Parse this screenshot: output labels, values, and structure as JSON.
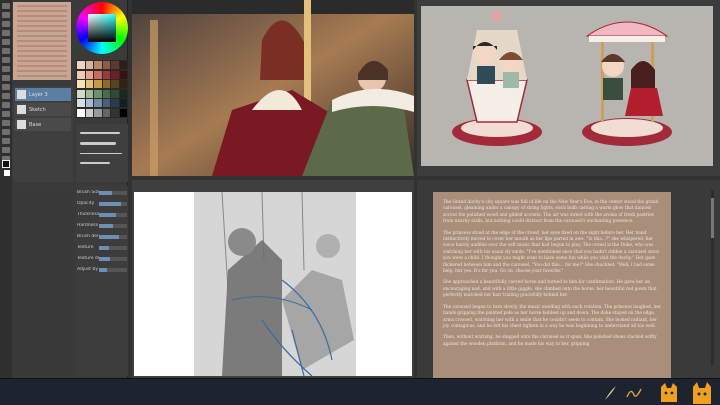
{
  "layers": {
    "items": [
      {
        "label": "Layer 3"
      },
      {
        "label": "Sketch"
      },
      {
        "label": "Base"
      }
    ]
  },
  "tool_properties": {
    "rows": [
      {
        "label": "Brush Size",
        "value": 0.45
      },
      {
        "label": "Opacity",
        "value": 0.8
      },
      {
        "label": "Thickness",
        "value": 0.6
      },
      {
        "label": "Hardness",
        "value": 0.5
      },
      {
        "label": "Brush density",
        "value": 0.7
      },
      {
        "label": "Texture",
        "value": 0.35
      },
      {
        "label": "Texture density",
        "value": 0.4
      },
      {
        "label": "Adjust by speed",
        "value": 0.3
      }
    ]
  },
  "story": {
    "paragraphs": [
      "The Grand duchy's city square was full of life on the New Year's Eve, in the center stood the grand carousel, gleaming under a canopy of string lights, each bulb casting a warm glow that danced across the polished wood and gilded accents. The air was sweet with the aroma of fresh pastries from nearby stalls, but nothing could distract from the carousel's enchanting presence.",
      "The princess stood at the edge of the crowd, her eyes fixed on the sight before her. Her hand instinctively moved to cover her mouth as her lips parted in awe. \"Is this...?\" she whispered, her voice barely audible over the soft music that had begun to play. The crowd is the Duke, who was watching her with his usual sly smile. \"I've mentioned once that you hadn't ridden a carousel since you were a child. I thought you might want to have some fun while you visit the duchy.\" Her gaze flickered between him and the carousel. \"You did this... for me?\" She chuckled. \"Well, I had some help, but yes. It's for you. Go on, choose your favorite.\"",
      "She approached a beautifully carved horse and turned to him for confirmation. He gave her an encouraging nod, and with a little giggle, she climbed onto the horse, her beautiful red gown that perfectly matched her hair trailing gracefully behind her.",
      "The carousel began to turn slowly, the music swelling with each rotation. The princess laughed, her hands gripping the painted pole as her horse bobbed up and down. The duke stayed on the edge, arms crossed, watching her with a smile that he couldn't seem to contain. She looked radiant, her joy contagious, and he felt his chest tighten in a way he was beginning to understand all too well.",
      "Then, without warning, he stepped onto the carousel as it spun. She polished shoes clacked softly against the wooden platform, and he made his way to her, gripping"
    ]
  },
  "colors": {
    "accent": "#5d7ea3",
    "memo": "#c9a594",
    "page": "#a98f7b",
    "taskbar": "#1e2330"
  }
}
